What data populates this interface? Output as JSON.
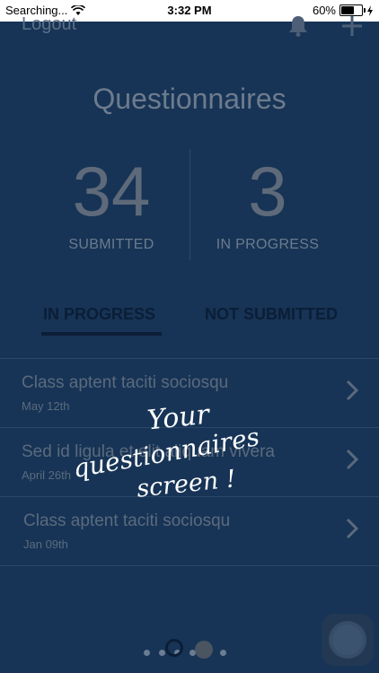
{
  "status_bar": {
    "carrier": "Searching...",
    "time": "3:32 PM",
    "battery": "60%",
    "battery_level": 0.6
  },
  "header": {
    "logout_label": "Logout",
    "bell_icon": "bell-icon",
    "plus_icon": "plus-icon"
  },
  "title": "Questionnaires",
  "stats": {
    "submitted": {
      "count": "34",
      "label": "SUBMITTED"
    },
    "in_progress": {
      "count": "3",
      "label": "IN PROGRESS"
    }
  },
  "tabs": [
    {
      "label": "IN PROGRESS",
      "active": true
    },
    {
      "label": "NOT SUBMITTED",
      "active": false
    }
  ],
  "list": [
    {
      "title": "Class aptent taciti sociosqu",
      "date": "May 12th"
    },
    {
      "title": "Sed id ligula et elit aliquam vivera",
      "date": "April 26th"
    },
    {
      "title": "Class aptent taciti sociosqu",
      "date": "Jan 09th"
    }
  ],
  "overlay": {
    "line1": "Your",
    "line2": "questionnaires",
    "line3": "screen !"
  },
  "page_indicator": {
    "count": 6,
    "active_index": 4
  },
  "colors": {
    "background": "#173456",
    "tab_active": "#0b1e36",
    "divider": "#2b4868"
  }
}
